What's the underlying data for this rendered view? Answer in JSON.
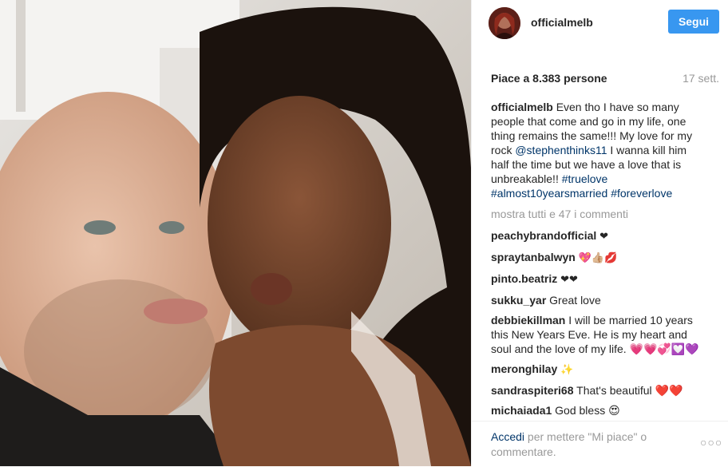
{
  "post": {
    "username": "officialmelb",
    "follow_label": "Segui",
    "likes_label": "Piace a 8.383 persone",
    "time_ago": "17 sett.",
    "caption": {
      "username": "officialmelb",
      "text_1": "Even tho I have so many people that come and go in my life, one thing remains the same!!! My love for my rock ",
      "mention": "@stephenthinks11",
      "text_2": " I wanna kill him half the time but we have a love that is unbreakable!! ",
      "hashtag_1": "#truelove",
      "hashtag_2": "#almost10yearsmarried",
      "hashtag_3": "#foreverlove"
    },
    "show_all_comments": "mostra tutti e 47 i commenti",
    "comments": [
      {
        "username": "peachybrandofficial",
        "text": "❤"
      },
      {
        "username": "spraytanbalwyn",
        "text": "💖👍🏼💋"
      },
      {
        "username": "pinto.beatriz",
        "text": "❤❤"
      },
      {
        "username": "sukku_yar",
        "text": "Great love"
      },
      {
        "username": "debbiekillman",
        "text": "I will be married 10 years this New Years Eve. He is my heart and soul and the love of my life. 💗💗💞💟💜"
      },
      {
        "username": "meronghilay",
        "text": "✨"
      },
      {
        "username": "sandraspiteri68",
        "text": "That's beautiful ❤️❤️"
      },
      {
        "username": "michaiada1",
        "text": "God bless 😍"
      }
    ]
  },
  "footer": {
    "login_link": "Accedi",
    "login_rest": " per mettere \"Mi piace\" o commentare.",
    "more_icon": "more-options-icon"
  },
  "colors": {
    "follow_button": "#3897f0",
    "link": "#003569",
    "muted": "#999999"
  }
}
